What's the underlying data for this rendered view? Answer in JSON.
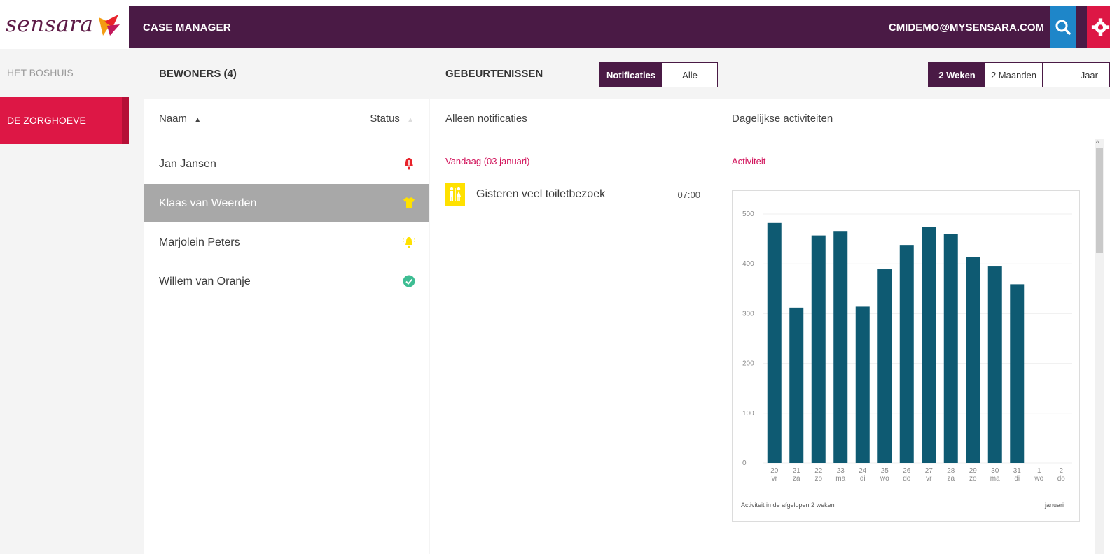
{
  "brand": {
    "logo_text": "sensara",
    "accent_color": "#dd1745",
    "header_color": "#4a1a45"
  },
  "sidebar": {
    "items": [
      {
        "label": "HET BOSHUIS",
        "active": false
      },
      {
        "label": "DE ZORGHOEVE",
        "active": true
      }
    ]
  },
  "topbar": {
    "title": "CASE MANAGER",
    "user": "CMIDEMO@MYSENSARA.COM",
    "icons": [
      "search-icon",
      "gear-icon"
    ]
  },
  "residents": {
    "header": "BEWONERS (4)",
    "col_name": "Naam",
    "col_status": "Status",
    "rows": [
      {
        "name": "Jan Jansen",
        "status_icon": "bell-alarm-icon",
        "status_color": "#e8232b",
        "selected": false
      },
      {
        "name": "Klaas van Weerden",
        "status_icon": "shirt-icon",
        "status_color": "#ffe100",
        "selected": true
      },
      {
        "name": "Marjolein Peters",
        "status_icon": "bell-ringing-icon",
        "status_color": "#ffe100",
        "selected": false
      },
      {
        "name": "Willem van Oranje",
        "status_icon": "check-circle-icon",
        "status_color": "#3ebd93",
        "selected": false
      }
    ]
  },
  "events": {
    "header": "GEBEURTENISSEN",
    "filters": [
      {
        "label": "Notificaties",
        "active": true
      },
      {
        "label": "Alle",
        "active": false
      }
    ],
    "subheader": "Alleen notificaties",
    "day_label": "Vandaag (03 januari)",
    "items": [
      {
        "title": "Gisteren veel toiletbezoek",
        "time": "07:00",
        "icon": "toilet-icon"
      }
    ]
  },
  "period": {
    "options": [
      {
        "label": "2 Weken",
        "active": true
      },
      {
        "label": "2 Maanden",
        "active": false
      },
      {
        "label": "Jaar",
        "active": false
      }
    ]
  },
  "activity": {
    "header": "Dagelijkse activiteiten",
    "subheader": "Activiteit",
    "footer_left": "Activiteit in de afgelopen 2 weken",
    "footer_right": "januari"
  },
  "chart_data": {
    "type": "bar",
    "title": "",
    "xlabel": "",
    "ylabel": "",
    "ylim": [
      0,
      500
    ],
    "yticks": [
      0,
      100,
      200,
      300,
      400,
      500
    ],
    "categories": [
      "20",
      "21",
      "22",
      "23",
      "24",
      "25",
      "26",
      "27",
      "28",
      "29",
      "30",
      "31",
      "1",
      "2"
    ],
    "sublabels": [
      "vr",
      "za",
      "zo",
      "ma",
      "di",
      "wo",
      "do",
      "vr",
      "za",
      "zo",
      "ma",
      "di",
      "wo",
      "do"
    ],
    "values": [
      482,
      312,
      457,
      466,
      314,
      389,
      438,
      474,
      460,
      414,
      396,
      359,
      null,
      null
    ],
    "bar_color": "#0e5a72",
    "grid": true
  }
}
